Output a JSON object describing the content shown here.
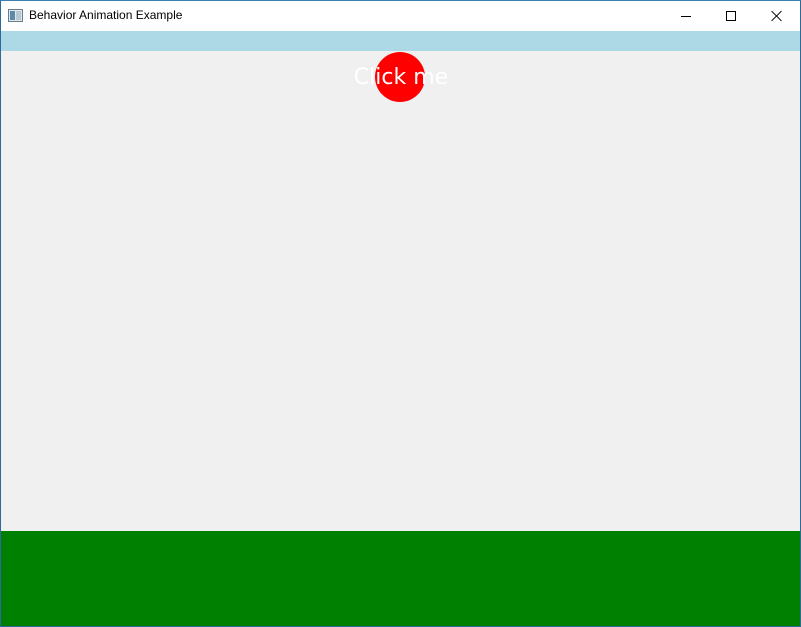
{
  "window": {
    "title": "Behavior Animation Example",
    "icon": "app-window-icon",
    "controls": {
      "minimize_icon": "minimize-icon",
      "maximize_icon": "maximize-icon",
      "close_icon": "close-icon"
    }
  },
  "main": {
    "button_label": "Click me",
    "colors": {
      "top_band": "#add8e6",
      "background": "#f0f0f0",
      "button": "#ff0000",
      "button_text": "#ffffff",
      "bottom_band": "#008000"
    }
  }
}
